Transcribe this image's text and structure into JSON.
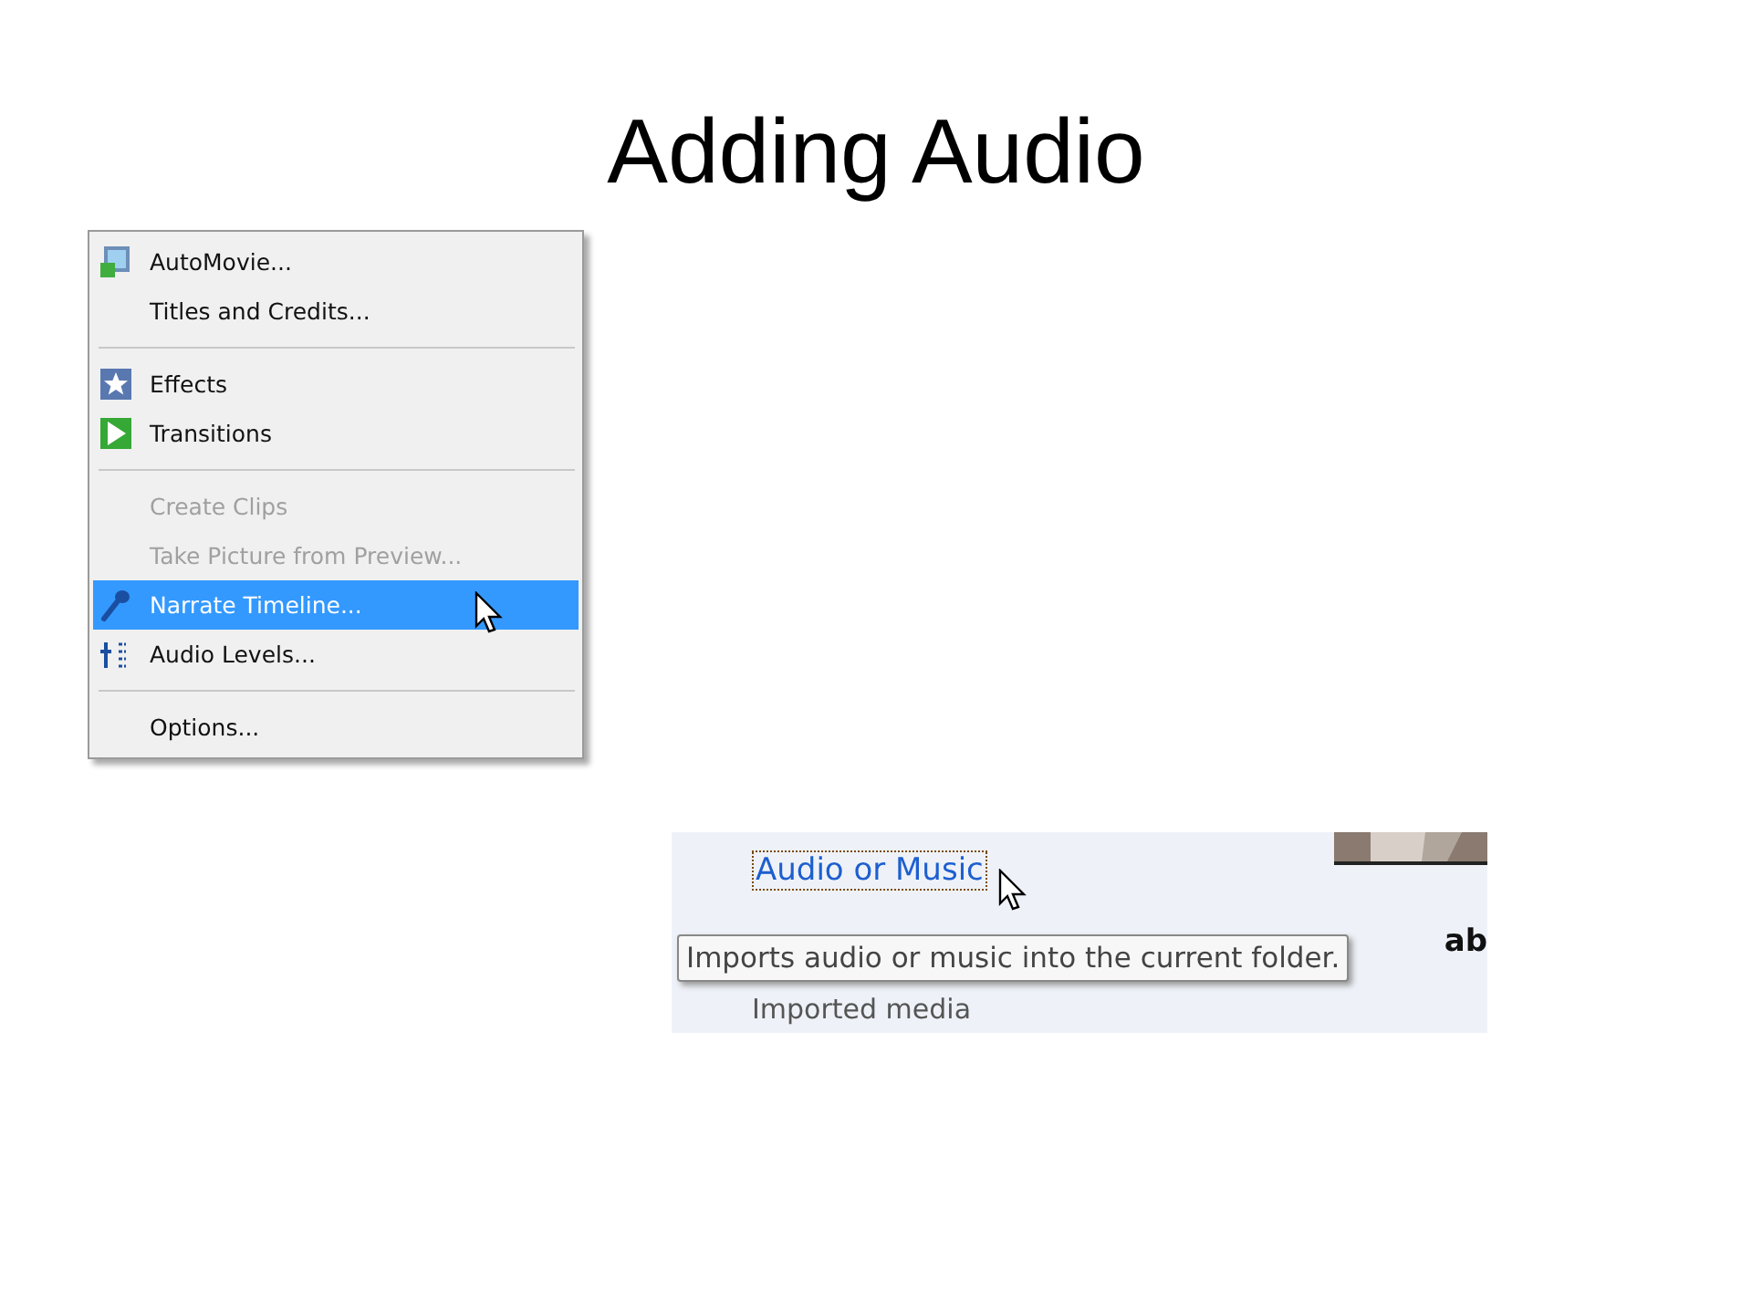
{
  "slide": {
    "title": "Adding Audio"
  },
  "menu": {
    "items": [
      {
        "kind": "film",
        "label": "AutoMovie...",
        "disabled": false,
        "selected": false
      },
      {
        "kind": "plain",
        "label": "Titles and Credits...",
        "disabled": false,
        "selected": false
      },
      {
        "kind": "separator"
      },
      {
        "kind": "star",
        "label": "Effects",
        "disabled": false,
        "selected": false
      },
      {
        "kind": "play",
        "label": "Transitions",
        "disabled": false,
        "selected": false
      },
      {
        "kind": "separator"
      },
      {
        "kind": "plain",
        "label": "Create Clips",
        "disabled": true,
        "selected": false
      },
      {
        "kind": "plain",
        "label": "Take Picture from Preview...",
        "disabled": true,
        "selected": false
      },
      {
        "kind": "mic",
        "label": "Narrate Timeline...",
        "disabled": false,
        "selected": true
      },
      {
        "kind": "levels",
        "label": "Audio Levels...",
        "disabled": false,
        "selected": false
      },
      {
        "kind": "separator"
      },
      {
        "kind": "plain",
        "label": "Options...",
        "disabled": false,
        "selected": false
      }
    ]
  },
  "import_panel": {
    "link": "Audio or Music",
    "tooltip": "Imports audio or music into the current folder.",
    "side_text": "ab",
    "section": "Imported media"
  }
}
